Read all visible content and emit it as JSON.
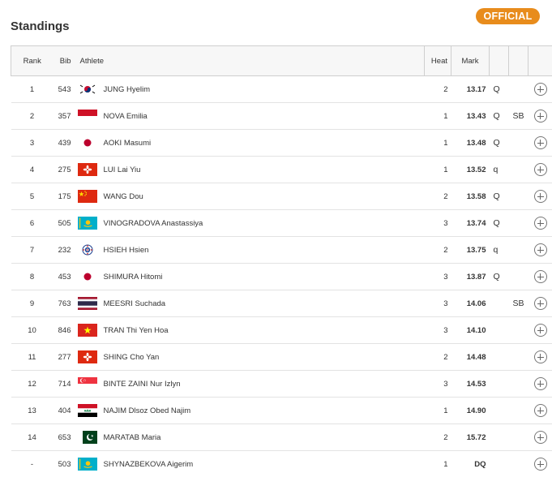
{
  "header": {
    "title": "Standings",
    "status_badge": "OFFICIAL"
  },
  "columns": {
    "rank": "Rank",
    "bib": "Bib",
    "athlete": "Athlete",
    "heat": "Heat",
    "mark": "Mark"
  },
  "rows": [
    {
      "rank": "1",
      "bib": "543",
      "athlete": "JUNG Hyelim",
      "flag": "korea",
      "heat": "2",
      "mark": "13.17",
      "q": "Q",
      "sb": ""
    },
    {
      "rank": "2",
      "bib": "357",
      "athlete": "NOVA Emilia",
      "flag": "indonesia",
      "heat": "1",
      "mark": "13.43",
      "q": "Q",
      "sb": "SB"
    },
    {
      "rank": "3",
      "bib": "439",
      "athlete": "AOKI Masumi",
      "flag": "japan",
      "heat": "1",
      "mark": "13.48",
      "q": "Q",
      "sb": ""
    },
    {
      "rank": "4",
      "bib": "275",
      "athlete": "LUI Lai Yiu",
      "flag": "hongkong",
      "heat": "1",
      "mark": "13.52",
      "q": "q",
      "sb": ""
    },
    {
      "rank": "5",
      "bib": "175",
      "athlete": "WANG Dou",
      "flag": "china",
      "heat": "2",
      "mark": "13.58",
      "q": "Q",
      "sb": ""
    },
    {
      "rank": "6",
      "bib": "505",
      "athlete": "VINOGRADOVA Anastassiya",
      "flag": "kazakhstan",
      "heat": "3",
      "mark": "13.74",
      "q": "Q",
      "sb": ""
    },
    {
      "rank": "7",
      "bib": "232",
      "athlete": "HSIEH Hsien",
      "flag": "chinese-taipei",
      "heat": "2",
      "mark": "13.75",
      "q": "q",
      "sb": ""
    },
    {
      "rank": "8",
      "bib": "453",
      "athlete": "SHIMURA Hitomi",
      "flag": "japan",
      "heat": "3",
      "mark": "13.87",
      "q": "Q",
      "sb": ""
    },
    {
      "rank": "9",
      "bib": "763",
      "athlete": "MEESRI Suchada",
      "flag": "thailand",
      "heat": "3",
      "mark": "14.06",
      "q": "",
      "sb": "SB"
    },
    {
      "rank": "10",
      "bib": "846",
      "athlete": "TRAN Thi Yen Hoa",
      "flag": "vietnam",
      "heat": "3",
      "mark": "14.10",
      "q": "",
      "sb": ""
    },
    {
      "rank": "11",
      "bib": "277",
      "athlete": "SHING Cho Yan",
      "flag": "hongkong",
      "heat": "2",
      "mark": "14.48",
      "q": "",
      "sb": ""
    },
    {
      "rank": "12",
      "bib": "714",
      "athlete": "BINTE ZAINI Nur Izlyn",
      "flag": "singapore",
      "heat": "3",
      "mark": "14.53",
      "q": "",
      "sb": ""
    },
    {
      "rank": "13",
      "bib": "404",
      "athlete": "NAJIM Dlsoz Obed Najim",
      "flag": "iraq",
      "heat": "1",
      "mark": "14.90",
      "q": "",
      "sb": ""
    },
    {
      "rank": "14",
      "bib": "653",
      "athlete": "MARATAB Maria",
      "flag": "pakistan",
      "heat": "2",
      "mark": "15.72",
      "q": "",
      "sb": ""
    },
    {
      "rank": "-",
      "bib": "503",
      "athlete": "SHYNAZBEKOVA Aigerim",
      "flag": "kazakhstan",
      "heat": "1",
      "mark": "DQ",
      "q": "",
      "sb": ""
    }
  ]
}
